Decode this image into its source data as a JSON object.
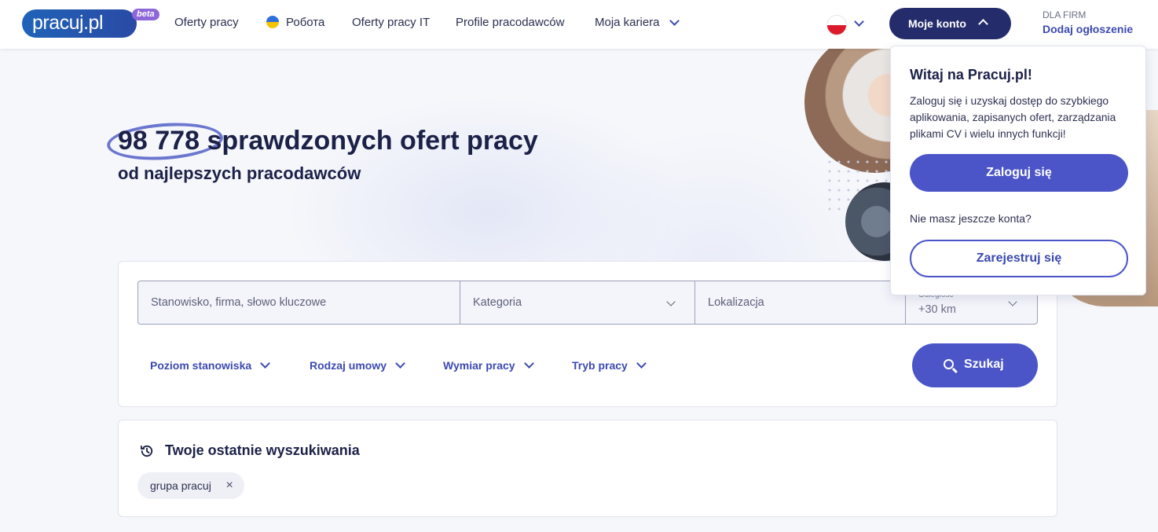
{
  "header": {
    "logo_text": "pracuj.pl",
    "logo_badge": "beta",
    "nav": [
      {
        "label": "Oferty pracy"
      },
      {
        "label": "Робота"
      },
      {
        "label": "Oferty pracy IT"
      },
      {
        "label": "Profile pracodawców"
      },
      {
        "label": "Moja kariera"
      }
    ],
    "account_button": "Moje konto",
    "firm_label": "DLA FIRM",
    "firm_link": "Dodaj ogłoszenie"
  },
  "hero": {
    "count": "98 778",
    "title_rest": "sprawdzonych ofert pracy",
    "subtitle": "od najlepszych pracodawców"
  },
  "search": {
    "keyword_placeholder": "Stanowisko, firma, słowo kluczowe",
    "category_placeholder": "Kategoria",
    "location_placeholder": "Lokalizacja",
    "distance_label": "Odległość",
    "distance_value": "+30 km",
    "filters": [
      {
        "label": "Poziom stanowiska"
      },
      {
        "label": "Rodzaj umowy"
      },
      {
        "label": "Wymiar pracy"
      },
      {
        "label": "Tryb pracy"
      }
    ],
    "search_button": "Szukaj"
  },
  "recent": {
    "title": "Twoje ostatnie wyszukiwania",
    "chips": [
      {
        "label": "grupa pracuj",
        "remove": "×"
      }
    ]
  },
  "login_popover": {
    "title": "Witaj na Pracuj.pl!",
    "description": "Zaloguj się i uzyskaj dostęp do szybkiego aplikowania, zapisanych ofert, zarządzania plikami CV i wielu innych funkcji!",
    "login_button": "Zaloguj się",
    "no_account": "Nie masz jeszcze konta?",
    "register_button": "Zarejestruj się"
  },
  "colors": {
    "brand_dark": "#252c6b",
    "accent": "#4b55c8",
    "link": "#3c49b1",
    "title": "#1c2148"
  }
}
